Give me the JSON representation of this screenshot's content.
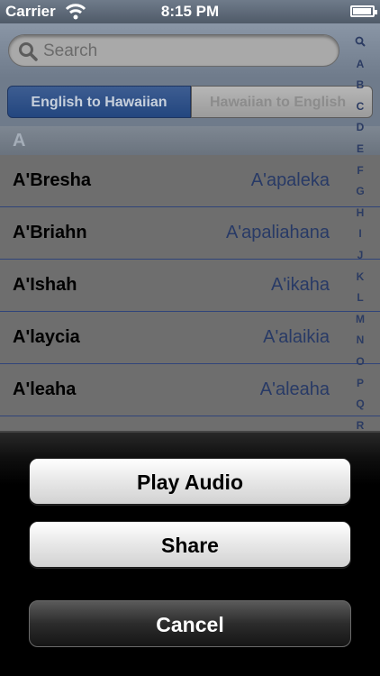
{
  "status_bar": {
    "carrier": "Carrier",
    "time": "8:15 PM",
    "battery_level": 0.95
  },
  "search": {
    "placeholder": "Search",
    "icon": "search-icon"
  },
  "segments": [
    {
      "label": "English to Hawaiian",
      "selected": true
    },
    {
      "label": "Hawaiian to English",
      "selected": false
    }
  ],
  "section": {
    "header": "A"
  },
  "rows": [
    {
      "name": "A'Bresha",
      "hawaiian": "A'apaleka"
    },
    {
      "name": "A'Briahn",
      "hawaiian": "A'apaliahana"
    },
    {
      "name": "A'Ishah",
      "hawaiian": "A'ikaha"
    },
    {
      "name": "A'laycia",
      "hawaiian": "A'alaikia"
    },
    {
      "name": "A'leaha",
      "hawaiian": "A'aleaha"
    }
  ],
  "index": [
    "A",
    "B",
    "C",
    "D",
    "E",
    "F",
    "G",
    "H",
    "I",
    "J",
    "K",
    "L",
    "M",
    "N",
    "O",
    "P",
    "Q",
    "R"
  ],
  "action_sheet": {
    "play_audio": "Play Audio",
    "share": "Share",
    "cancel": "Cancel"
  },
  "colors": {
    "segment_active": "#23467f",
    "hawaiian_text": "#283a66"
  }
}
